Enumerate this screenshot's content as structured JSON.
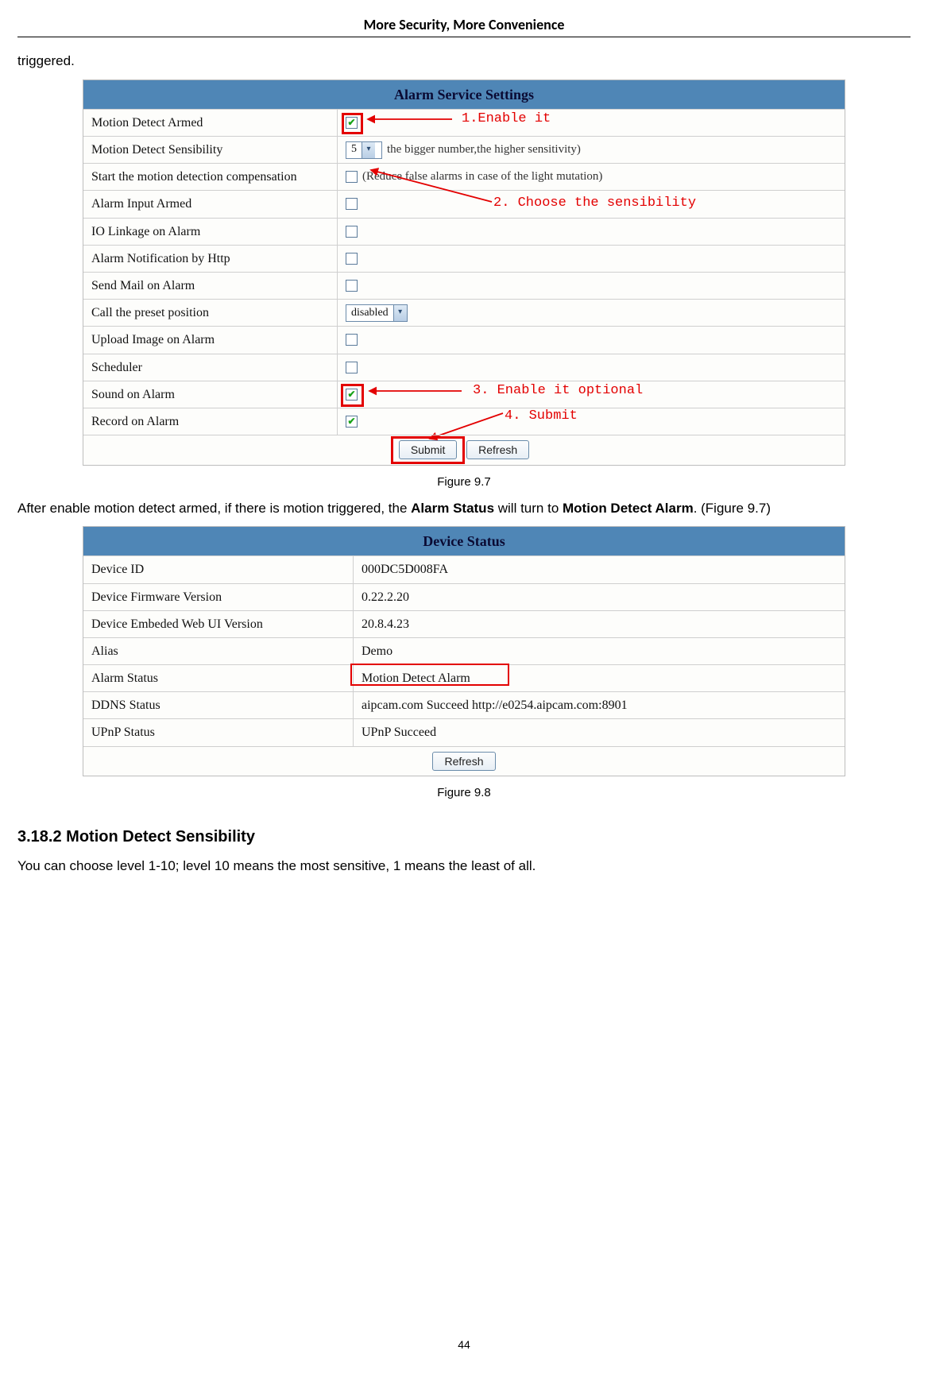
{
  "header": "More Security, More Convenience",
  "intro_top": "triggered.",
  "fig97_caption": "Figure 9.7",
  "after_text_1": "After enable motion detect armed, if there is motion triggered, the ",
  "after_text_bold1": "Alarm Status",
  "after_text_2": " will turn to ",
  "after_text_bold2": "Motion Detect Alarm",
  "after_text_3": ". (Figure 9.7)",
  "fig98_caption": "Figure 9.8",
  "section_heading": "3.18.2 Motion Detect Sensibility",
  "section_body": "You can choose level 1-10; level 10 means the most sensitive, 1 means the least of all.",
  "page_number": "44",
  "alarm": {
    "title": "Alarm Service Settings",
    "rows": {
      "motion_detect_armed": "Motion Detect Armed",
      "motion_detect_sensibility": "Motion Detect Sensibility",
      "start_compensation": "Start the motion detection compensation",
      "alarm_input_armed": "Alarm Input Armed",
      "io_linkage": "IO Linkage on Alarm",
      "alarm_http": "Alarm Notification by Http",
      "send_mail": "Send Mail on Alarm",
      "call_preset": "Call the preset position",
      "upload_image": "Upload Image on Alarm",
      "scheduler": "Scheduler",
      "sound_on_alarm": "Sound on Alarm",
      "record_on_alarm": "Record on Alarm"
    },
    "sensibility_value": "5",
    "sensibility_note": "the bigger number,the higher sensitivity)",
    "compensation_note": "(Reduce false alarms in case of the light mutation)",
    "call_preset_value": "disabled",
    "submit_label": "Submit",
    "refresh_label": "Refresh",
    "annotations": {
      "a1": "1.Enable it",
      "a2": "2. Choose the sensibility",
      "a3": "3. Enable it optional",
      "a4": "4. Submit"
    }
  },
  "status": {
    "title": "Device Status",
    "rows": {
      "device_id_l": "Device ID",
      "device_id_v": "000DC5D008FA",
      "fw_l": "Device Firmware Version",
      "fw_v": "0.22.2.20",
      "web_l": "Device Embeded Web UI Version",
      "web_v": "20.8.4.23",
      "alias_l": "Alias",
      "alias_v": "Demo",
      "alarm_l": "Alarm Status",
      "alarm_v": "Motion Detect Alarm",
      "ddns_l": "DDNS Status",
      "ddns_v": "aipcam.com  Succeed  http://e0254.aipcam.com:8901",
      "upnp_l": "UPnP Status",
      "upnp_v": "UPnP Succeed"
    },
    "refresh_label": "Refresh"
  }
}
